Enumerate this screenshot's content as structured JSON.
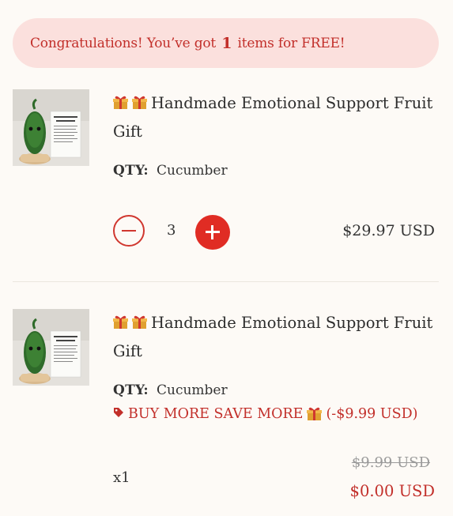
{
  "banner": {
    "prefix": "Congratulations! You’ve got",
    "count": "1",
    "suffix": "items for FREE!"
  },
  "items": [
    {
      "title": "Handmade Emotional Support Fruit Gift",
      "qty_label": "QTY:",
      "variant": "Cucumber",
      "quantity": "3",
      "price": "$29.97 USD"
    },
    {
      "title": "Handmade Emotional Support Fruit Gift",
      "qty_label": "QTY:",
      "variant": "Cucumber",
      "promo": "BUY MORE SAVE MORE",
      "promo_discount": "(-$9.99 USD)",
      "quantity_text": "x1",
      "original_price": "$9.99 USD",
      "price": "$0.00 USD"
    }
  ],
  "icons": {
    "gift": "gift-icon",
    "tag": "price-tag-icon",
    "minus": "minus-icon",
    "plus": "plus-icon"
  },
  "colors": {
    "accent": "#e02c24",
    "banner_bg": "#fbe0dd",
    "banner_text": "#c22f2a",
    "page_bg": "#fdfaf6"
  }
}
